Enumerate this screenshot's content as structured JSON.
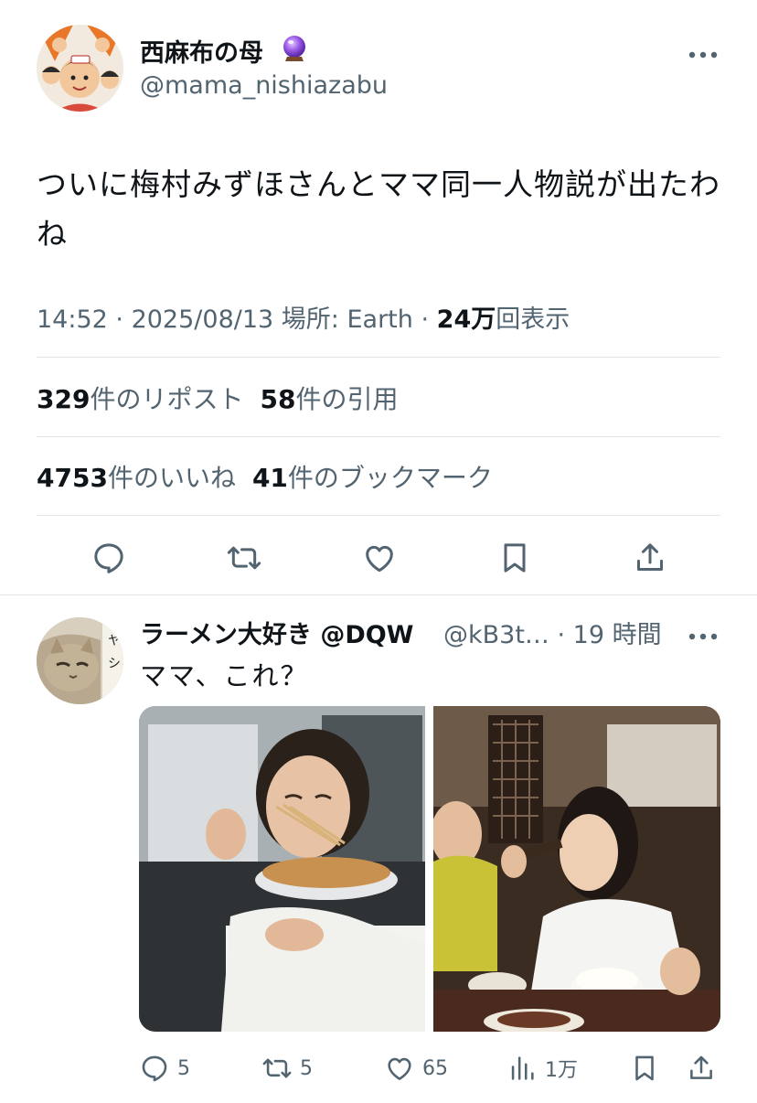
{
  "tweet": {
    "display_name": "西麻布の母",
    "badge_icon": "crystal-ball-emoji",
    "handle": "@mama_nishiazabu",
    "text": "ついに梅村みずほさんとママ同一人物説が出たわね",
    "time": "14:52",
    "date": "2025/08/13",
    "location": "場所: Earth",
    "views_count": "24万",
    "views_label": "回表示",
    "reposts_count": "329",
    "reposts_label": "件のリポスト",
    "quotes_count": "58",
    "quotes_label": "件の引用",
    "likes_count": "4753",
    "likes_label": "件のいいね",
    "bookmarks_count": "41",
    "bookmarks_label": "件のブックマーク",
    "actions": [
      "reply-icon",
      "repost-icon",
      "like-icon",
      "bookmark-icon",
      "share-icon"
    ]
  },
  "reply": {
    "display_name": "ラーメン大好き @DQW",
    "handle_time": "@kB3t… · 19 時間",
    "text": "ママ、これ？",
    "replies": "5",
    "reposts": "5",
    "likes": "65",
    "views": "1万"
  },
  "colors": {
    "text_primary": "#0f1419",
    "text_secondary": "#536471",
    "divider": "#e1e5e8",
    "orb": "#8a4fd8"
  }
}
